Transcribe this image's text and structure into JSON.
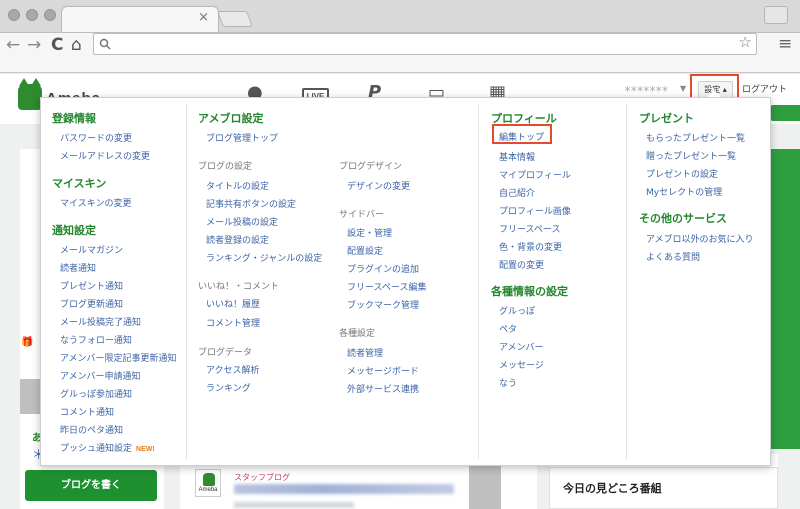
{
  "browser": {
    "tab_close": "×",
    "back": "←",
    "forward": "→",
    "reload": "C",
    "home": "⌂",
    "bookmark_star": "☆",
    "menu": "≡",
    "address_value": ""
  },
  "header": {
    "logo_word": "Ameba",
    "user_mask": "*******",
    "user_arrow": "▼",
    "settings_label": "設定 ▴",
    "logout_label": "ログアウト",
    "live_label": "LIVE",
    "icons": [
      "person-icon",
      "live-icon",
      "pigg-icon",
      "game-icon",
      "app-icon"
    ]
  },
  "background": {
    "write_button": "ブログを書く",
    "staff_badge": "Ameba",
    "staff_title": "スタッフブログ",
    "today_title": "今日の見どころ番組",
    "sidebar_snip": "あ",
    "sidebar_star": "＊",
    "gift_icon": "🎁"
  },
  "menu": {
    "col1": {
      "registration": {
        "title": "登録情報",
        "items": [
          "パスワードの変更",
          "メールアドレスの変更"
        ]
      },
      "myskin": {
        "title": "マイスキン",
        "items": [
          "マイスキンの変更"
        ]
      },
      "notifications": {
        "title": "通知設定",
        "items": [
          "メールマガジン",
          "読者通知",
          "プレゼント通知",
          "ブログ更新通知",
          "メール投稿完了通知",
          "なうフォロー通知",
          "アメンバー限定記事更新通知",
          "アメンバー申請通知",
          "グルっぽ参加通知",
          "コメント通知",
          "昨日のペタ通知",
          "プッシュ通知設定"
        ],
        "new_badge": "NEW!"
      }
    },
    "col2": {
      "title": "アメブロ設定",
      "top_link": "ブログ管理トップ",
      "blog_settings": {
        "title": "ブログの設定",
        "items": [
          "タイトルの設定",
          "記事共有ボタンの設定",
          "メール投稿の設定",
          "読者登録の設定",
          "ランキング・ジャンルの設定"
        ]
      },
      "likes_comments": {
        "title": "いいね！・コメント",
        "items": [
          "いいね！履歴",
          "コメント管理"
        ]
      },
      "blog_data": {
        "title": "ブログデータ",
        "items": [
          "アクセス解析",
          "ランキング"
        ]
      }
    },
    "col3": {
      "blog_design": {
        "title": "ブログデザイン",
        "items": [
          "デザインの変更"
        ]
      },
      "sidebar": {
        "title": "サイドバー",
        "items": [
          "設定・管理",
          "配置設定",
          "プラグインの追加",
          "フリースペース編集",
          "ブックマーク管理"
        ]
      },
      "misc": {
        "title": "各種設定",
        "items": [
          "読者管理",
          "メッセージボード",
          "外部サービス連携"
        ]
      }
    },
    "col4": {
      "profile": {
        "title": "プロフィール",
        "items": [
          "編集トップ",
          "基本情報",
          "マイプロフィール",
          "自己紹介",
          "プロフィール画像",
          "フリースペース",
          "色・背景の変更",
          "配置の変更"
        ]
      },
      "various": {
        "title": "各種情報の設定",
        "items": [
          "グルっぽ",
          "ペタ",
          "アメンバー",
          "メッセージ",
          "なう"
        ]
      }
    },
    "col5": {
      "present": {
        "title": "プレゼント",
        "items": [
          "もらったプレゼント一覧",
          "贈ったプレゼント一覧",
          "プレゼントの設定",
          "Myセレクトの管理"
        ]
      },
      "other": {
        "title": "その他のサービス",
        "items": [
          "アメブロ以外のお気に入り",
          "よくある質問"
        ]
      }
    }
  },
  "colors": {
    "accent_green": "#23862d",
    "link_blue": "#3c64a5",
    "highlight_red": "#e44b2d",
    "new_orange": "#e07d1e"
  }
}
